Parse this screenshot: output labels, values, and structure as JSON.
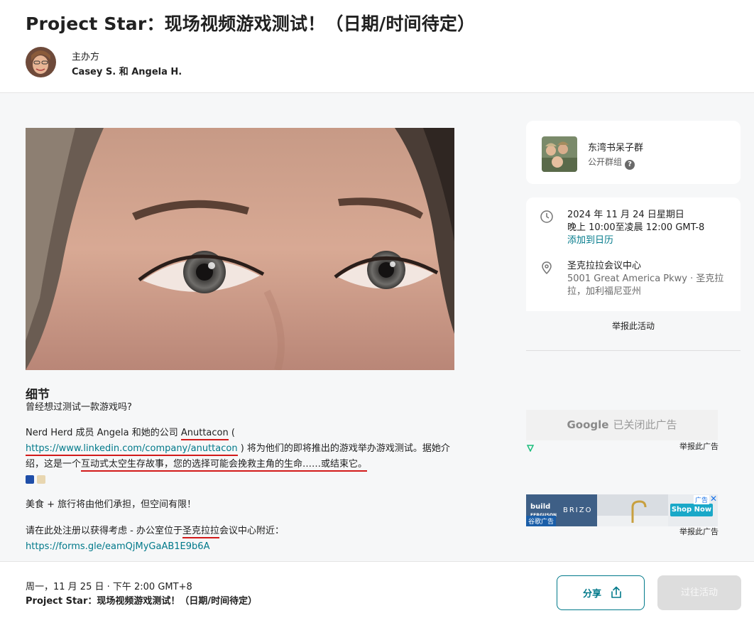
{
  "header": {
    "title": "Project Star：现场视频游戏测试！（日期/时间待定）",
    "host_label": "主办方",
    "host_names": "Casey S. 和 Angela H."
  },
  "details": {
    "heading": "细节",
    "p1": "曾经想过测试一款游戏吗?",
    "p2_a": "Nerd Herd 成员 Angela 和她的公司 ",
    "p2_company": "Anuttacon",
    "p2_b": " (",
    "p2_url": "https://www.linkedin.com/company/anuttacon",
    "p2_c": " ) 将为他们的即将推出的游戏举办游戏测试。据她介绍，这是一个",
    "p2_d": "互动式太空生存故事，您的选择可能会挽救主角的生命……或结束它。",
    "p3": "美食 + 旅行将由他们承担，但空间有限！",
    "p4_a": "请在此处注册以获得考虑 - 办公室位于",
    "p4_place": "圣克拉拉",
    "p4_b": "会议中心附近：",
    "p4_url": "https://forms.gle/eamQjMyGaAB1E9b6A"
  },
  "group": {
    "name": "东湾书呆子群",
    "type": "公开群组"
  },
  "event": {
    "date": "2024 年 11 月 24 日星期日",
    "time": "晚上 10:00至凌晨 12:00 GMT-8",
    "add_calendar": "添加到日历",
    "venue": "圣克拉拉会议中心",
    "address_line1": "5001 Great America Pkwy · 圣克拉",
    "address_line2": "拉，加利福尼亚州"
  },
  "report_event": "举报此活动",
  "ads": {
    "closed_brand": "Google",
    "closed_text": "已关闭此广告",
    "report_ad": "举报此广告",
    "ad_tag": "广告",
    "google_ads": "谷歌广告",
    "brand1_line1": "build",
    "brand1_line2": "FERGUSON",
    "brand2": "BRIZO",
    "shop_now": "Shop Now"
  },
  "footer": {
    "datetime": "周一，11 月 25 日 · 下午 2:00 GMT+8",
    "title": "Project Star：现场视频游戏测试！（日期/时间待定）",
    "share": "分享",
    "past_event": "过往活动"
  },
  "colors": {
    "accent": "#00798a",
    "annotation_red": "#d21a1a"
  }
}
